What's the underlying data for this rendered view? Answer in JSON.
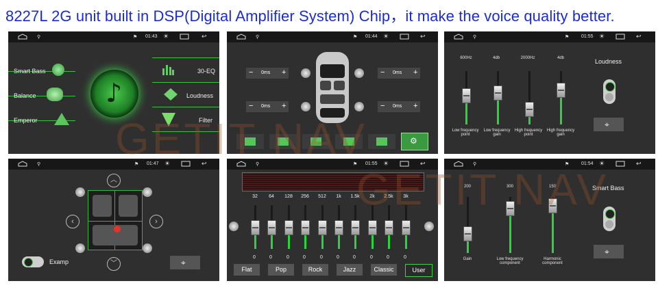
{
  "headline": "8227L 2G unit built in DSP(Digital Amplifier System) Chip，it make the voice quality better.",
  "watermark": "GETIT NAV",
  "p1": {
    "time": "01:43",
    "left": [
      "Smart Bass",
      "Balance",
      "Emperor"
    ],
    "right": [
      "30-EQ",
      "Loudness",
      "Filter"
    ]
  },
  "p2": {
    "time": "01:44",
    "delays": [
      "0ms",
      "0ms",
      "0ms",
      "0ms"
    ],
    "minus": "−",
    "plus": "+"
  },
  "p3": {
    "time": "01:55",
    "freqs": [
      "600Hz",
      "4db",
      "2000Hz",
      "4db"
    ],
    "labels": [
      "Low frequency point",
      "Low frequency gain",
      "High frequency point",
      "High frequency gain"
    ],
    "loudness": "Loudness",
    "levels": [
      0.55,
      0.6,
      0.3,
      0.65
    ]
  },
  "p4": {
    "time": "01:47",
    "toggle_label": "Examp"
  },
  "p5": {
    "time": "01:55",
    "bands": [
      "32",
      "64",
      "128",
      "256",
      "512",
      "1k",
      "1.5k",
      "2k",
      "2.5k",
      "3k"
    ],
    "zeros": [
      "0",
      "0",
      "0",
      "0",
      "0",
      "0",
      "0",
      "0",
      "0",
      "0"
    ],
    "presets": [
      "Flat",
      "Pop",
      "Rock",
      "Jazz",
      "Classic",
      "User"
    ],
    "selected_preset": "User"
  },
  "p6": {
    "time": "01:54",
    "values": [
      "200",
      "300",
      "150"
    ],
    "labels": [
      "Gain",
      "Low frequency component",
      "Harmonic component"
    ],
    "title": "Smart Bass",
    "levels": [
      0.35,
      0.8,
      0.85
    ]
  }
}
